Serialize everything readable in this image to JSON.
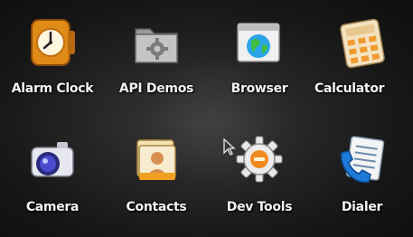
{
  "launcher": {
    "apps": [
      {
        "label": "Alarm Clock",
        "icon": "alarm-clock-icon"
      },
      {
        "label": "API Demos",
        "icon": "folder-gear-icon"
      },
      {
        "label": "Browser",
        "icon": "browser-globe-icon"
      },
      {
        "label": "Calculator",
        "icon": "calculator-icon"
      },
      {
        "label": "Camera",
        "icon": "camera-icon"
      },
      {
        "label": "Contacts",
        "icon": "contacts-icon"
      },
      {
        "label": "Dev Tools",
        "icon": "dev-tools-gear-icon"
      },
      {
        "label": "Dialer",
        "icon": "dialer-phone-icon"
      }
    ]
  },
  "colors": {
    "label_text": "#f2f2f2",
    "background": "#1a1a1a"
  }
}
